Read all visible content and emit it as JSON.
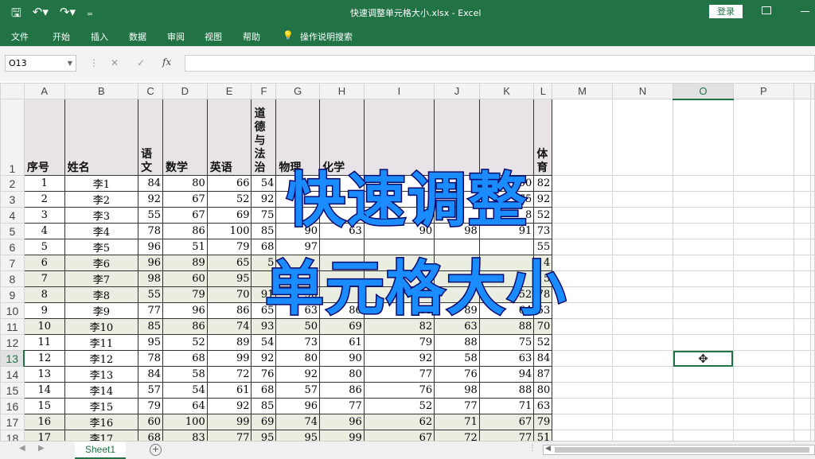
{
  "window": {
    "title": "快速调整单元格大小.xlsx  -  Excel",
    "login_label": "登录",
    "qat": [
      {
        "icon": "save-icon",
        "glyph": "🖫"
      },
      {
        "icon": "undo-icon",
        "glyph": "↶▾"
      },
      {
        "icon": "redo-icon",
        "glyph": "↷▾"
      },
      {
        "icon": "customize-icon",
        "glyph": "₌"
      }
    ]
  },
  "ribbon": {
    "tabs": [
      "文件",
      "开始",
      "插入",
      "数据",
      "审阅",
      "视图",
      "帮助"
    ],
    "tell_me": "操作说明搜索"
  },
  "formula_bar": {
    "name_box": "O13",
    "cancel": "✕",
    "enter": "✓",
    "fx": "fx",
    "value": ""
  },
  "columns": [
    "A",
    "B",
    "C",
    "D",
    "E",
    "F",
    "G",
    "H",
    "I",
    "J",
    "K",
    "L",
    "M",
    "N",
    "O",
    "P"
  ],
  "selected_cell": "O13",
  "header_row": [
    "序号",
    "姓名",
    "语文",
    "数学",
    "英语",
    "道德与法治",
    "物理",
    "化学",
    "",
    "",
    "",
    "体育"
  ],
  "rows": [
    [
      "1",
      "李1",
      "84",
      "80",
      "66",
      "54",
      "",
      "",
      "",
      "",
      "50",
      "82"
    ],
    [
      "2",
      "李2",
      "92",
      "67",
      "52",
      "92",
      "",
      "",
      "",
      "",
      "75",
      "92"
    ],
    [
      "3",
      "李3",
      "55",
      "67",
      "69",
      "75",
      "",
      "",
      "",
      "",
      "8",
      "52"
    ],
    [
      "4",
      "李4",
      "78",
      "86",
      "100",
      "85",
      "90",
      "63",
      "90",
      "98",
      "91",
      "73"
    ],
    [
      "5",
      "李5",
      "96",
      "51",
      "79",
      "68",
      "97",
      "",
      "",
      "",
      "",
      "55"
    ],
    [
      "6",
      "李6",
      "96",
      "89",
      "65",
      "5",
      "",
      "",
      "",
      "",
      "",
      "4"
    ],
    [
      "7",
      "李7",
      "98",
      "60",
      "95",
      "",
      "",
      "",
      "",
      "",
      "",
      "5"
    ],
    [
      "8",
      "李8",
      "55",
      "79",
      "70",
      "91",
      "90",
      "",
      "",
      "",
      "52",
      "78"
    ],
    [
      "9",
      "李9",
      "77",
      "96",
      "86",
      "65",
      "63",
      "86",
      "63",
      "89",
      "64",
      "53"
    ],
    [
      "10",
      "李10",
      "85",
      "86",
      "74",
      "93",
      "50",
      "69",
      "82",
      "63",
      "88",
      "70"
    ],
    [
      "11",
      "李11",
      "95",
      "52",
      "89",
      "54",
      "73",
      "61",
      "79",
      "88",
      "75",
      "52"
    ],
    [
      "12",
      "李12",
      "78",
      "68",
      "99",
      "92",
      "80",
      "90",
      "92",
      "58",
      "63",
      "84"
    ],
    [
      "13",
      "李13",
      "84",
      "58",
      "72",
      "76",
      "92",
      "80",
      "77",
      "76",
      "94",
      "87"
    ],
    [
      "14",
      "李14",
      "57",
      "54",
      "61",
      "68",
      "57",
      "86",
      "76",
      "98",
      "88",
      "80"
    ],
    [
      "15",
      "李15",
      "79",
      "64",
      "92",
      "85",
      "96",
      "77",
      "52",
      "77",
      "71",
      "63"
    ],
    [
      "16",
      "李16",
      "60",
      "100",
      "99",
      "69",
      "74",
      "96",
      "62",
      "71",
      "67",
      "79"
    ],
    [
      "17",
      "李17",
      "68",
      "83",
      "77",
      "95",
      "95",
      "99",
      "67",
      "72",
      "77",
      "51"
    ]
  ],
  "overlay": {
    "line1": "快速调整",
    "line2": "单元格大小"
  },
  "sheet_tabs": [
    "Sheet1"
  ],
  "colors": {
    "excel_green": "#217346",
    "band": "#e9eee0",
    "header_fill": "#e7e3e6",
    "overlay_fill": "#1a8cff",
    "overlay_stroke": "#0a0a6a"
  }
}
